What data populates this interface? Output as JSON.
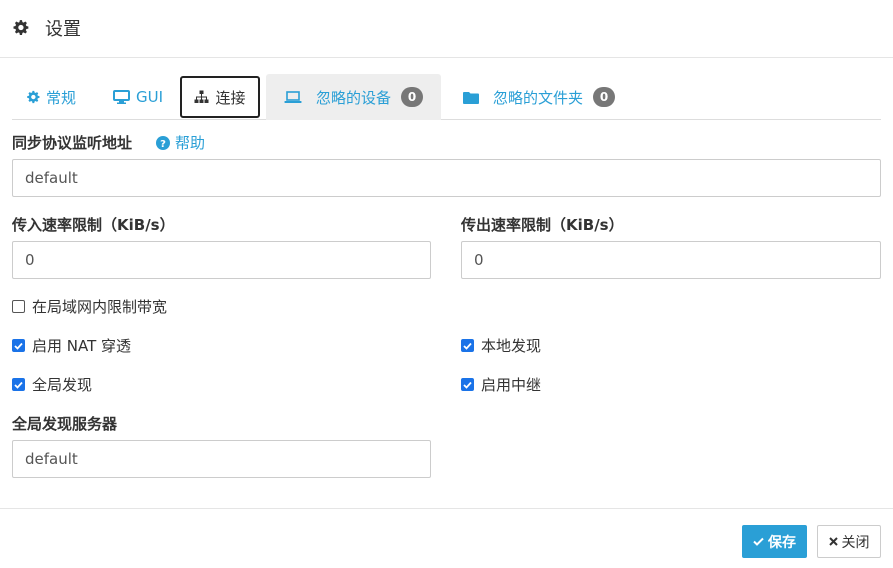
{
  "header": {
    "title": "设置",
    "icon": "gear-icon"
  },
  "tabs": [
    {
      "label": "常规",
      "icon": "gear-icon"
    },
    {
      "label": "GUI",
      "icon": "desktop-icon"
    },
    {
      "label": "连接",
      "icon": "sitemap-icon",
      "active": true
    },
    {
      "label": "忽略的设备",
      "icon": "laptop-icon",
      "badge": "0"
    },
    {
      "label": "忽略的文件夹",
      "icon": "folder-icon",
      "badge": "0"
    }
  ],
  "form": {
    "listen_label": "同步协议监听地址",
    "help_label": "帮助",
    "listen_value": "default",
    "in_rate_label": "传入速率限制（KiB/s）",
    "in_rate_value": "0",
    "out_rate_label": "传出速率限制（KiB/s）",
    "out_rate_value": "0",
    "lan_limit_label": "在局域网内限制带宽",
    "lan_limit_checked": false,
    "nat_label": "启用 NAT 穿透",
    "nat_checked": true,
    "local_disc_label": "本地发现",
    "local_disc_checked": true,
    "global_disc_label": "全局发现",
    "global_disc_checked": true,
    "relay_label": "启用中继",
    "relay_checked": true,
    "global_server_label": "全局发现服务器",
    "global_server_value": "default"
  },
  "footer": {
    "save_label": "保存",
    "close_label": "关闭"
  },
  "colors": {
    "accent": "#2a9fd6",
    "checkbox": "#1a73e8",
    "badge": "#777777"
  }
}
